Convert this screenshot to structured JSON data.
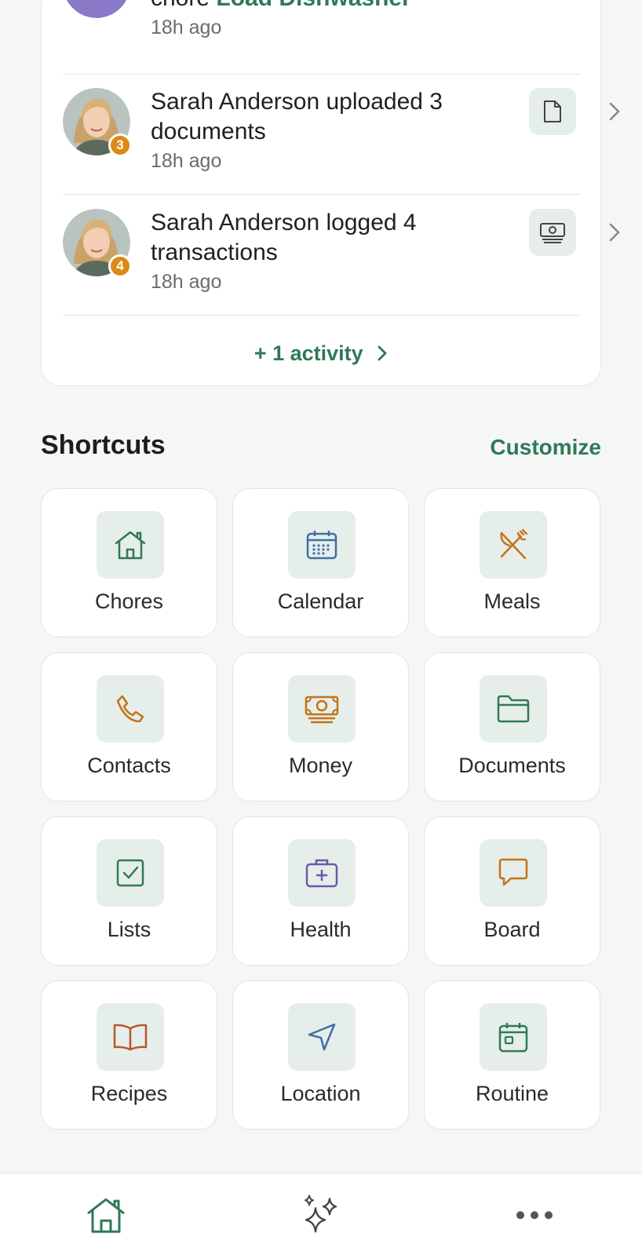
{
  "activity": {
    "items": [
      {
        "text_prefix": "chore ",
        "link": "Load Dishwasher",
        "time": "18h ago"
      },
      {
        "actor": "Sarah Anderson",
        "action": " uploaded 3 documents",
        "time": "18h ago",
        "badge": "3",
        "icon": "document-icon"
      },
      {
        "actor": "Sarah Anderson",
        "action": " logged 4 transactions",
        "time": "18h ago",
        "badge": "4",
        "icon": "money-icon"
      }
    ],
    "more": "+ 1 activity"
  },
  "shortcuts": {
    "title": "Shortcuts",
    "customize": "Customize",
    "tiles": [
      {
        "label": "Chores",
        "icon": "home-icon",
        "color": "#2e7a56"
      },
      {
        "label": "Calendar",
        "icon": "calendar-icon",
        "color": "#3f6fa8"
      },
      {
        "label": "Meals",
        "icon": "utensils-icon",
        "color": "#c2741a"
      },
      {
        "label": "Contacts",
        "icon": "phone-icon",
        "color": "#c2741a"
      },
      {
        "label": "Money",
        "icon": "money-icon",
        "color": "#c2741a"
      },
      {
        "label": "Documents",
        "icon": "folder-icon",
        "color": "#2e7a56"
      },
      {
        "label": "Lists",
        "icon": "checkbox-icon",
        "color": "#2e7a56"
      },
      {
        "label": "Health",
        "icon": "medical-kit-icon",
        "color": "#6a5aa8"
      },
      {
        "label": "Board",
        "icon": "message-icon",
        "color": "#c2741a"
      },
      {
        "label": "Recipes",
        "icon": "book-icon",
        "color": "#b8562e"
      },
      {
        "label": "Location",
        "icon": "navigation-icon",
        "color": "#3f6fa8"
      },
      {
        "label": "Routine",
        "icon": "routine-calendar-icon",
        "color": "#2e7a56"
      }
    ]
  },
  "nav": {
    "items": [
      {
        "icon": "home-icon"
      },
      {
        "icon": "sparkles-icon"
      },
      {
        "icon": "more-icon"
      }
    ]
  },
  "colors": {
    "accent": "#2e7a56",
    "badge": "#dc8a14",
    "tile_bg": "#e6eee9"
  }
}
